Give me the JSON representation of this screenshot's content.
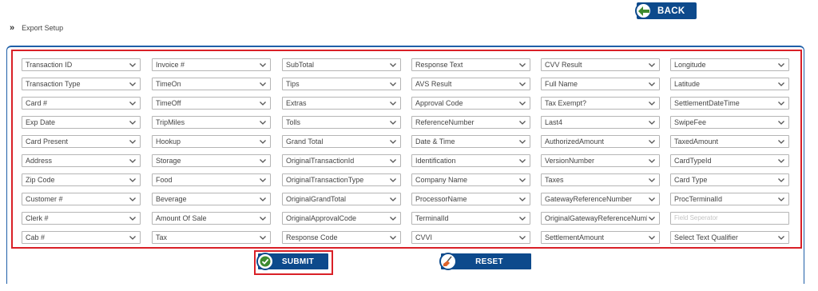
{
  "header": {
    "back_label": "BACK"
  },
  "breadcrumb": {
    "label": "Export Setup"
  },
  "columns": [
    [
      "Transaction ID",
      "Transaction Type",
      "Card #",
      "Exp Date",
      "Card Present",
      "Address",
      "Zip Code",
      "Customer #",
      "Clerk #",
      "Cab #"
    ],
    [
      "Invoice #",
      "TimeOn",
      "TimeOff",
      "TripMiles",
      "Hookup",
      "Storage",
      "Food",
      "Beverage",
      "Amount Of Sale",
      "Tax"
    ],
    [
      "SubTotal",
      "Tips",
      "Extras",
      "Tolls",
      "Grand Total",
      "OriginalTransactionId",
      "OriginalTransactionType",
      "OriginalGrandTotal",
      "OriginalApprovalCode",
      "Response Code"
    ],
    [
      "Response Text",
      "AVS Result",
      "Approval Code",
      "ReferenceNumber",
      "Date & Time",
      "Identification",
      "Company Name",
      "ProcessorName",
      "TerminalId",
      "CVVI"
    ],
    [
      "CVV Result",
      "Full Name",
      "Tax Exempt?",
      "Last4",
      "AuthorizedAmount",
      "VersionNumber",
      "Taxes",
      "GatewayReferenceNumber",
      "OriginalGatewayReferenceNumber",
      "SettlementAmount"
    ],
    [
      "Longitude",
      "Latitude",
      "SettlementDateTime",
      "SwipeFee",
      "TaxedAmount",
      "CardTypeId",
      "Card Type",
      "ProcTerminalId",
      "",
      "Select Text Qualifier"
    ]
  ],
  "field_separator_placeholder": "Field Seperator",
  "actions": {
    "submit_label": "SUBMIT",
    "reset_label": "RESET"
  },
  "colors": {
    "primary": "#0d4a8c",
    "highlight": "#d92027",
    "accent_green": "#3d8a2e"
  }
}
